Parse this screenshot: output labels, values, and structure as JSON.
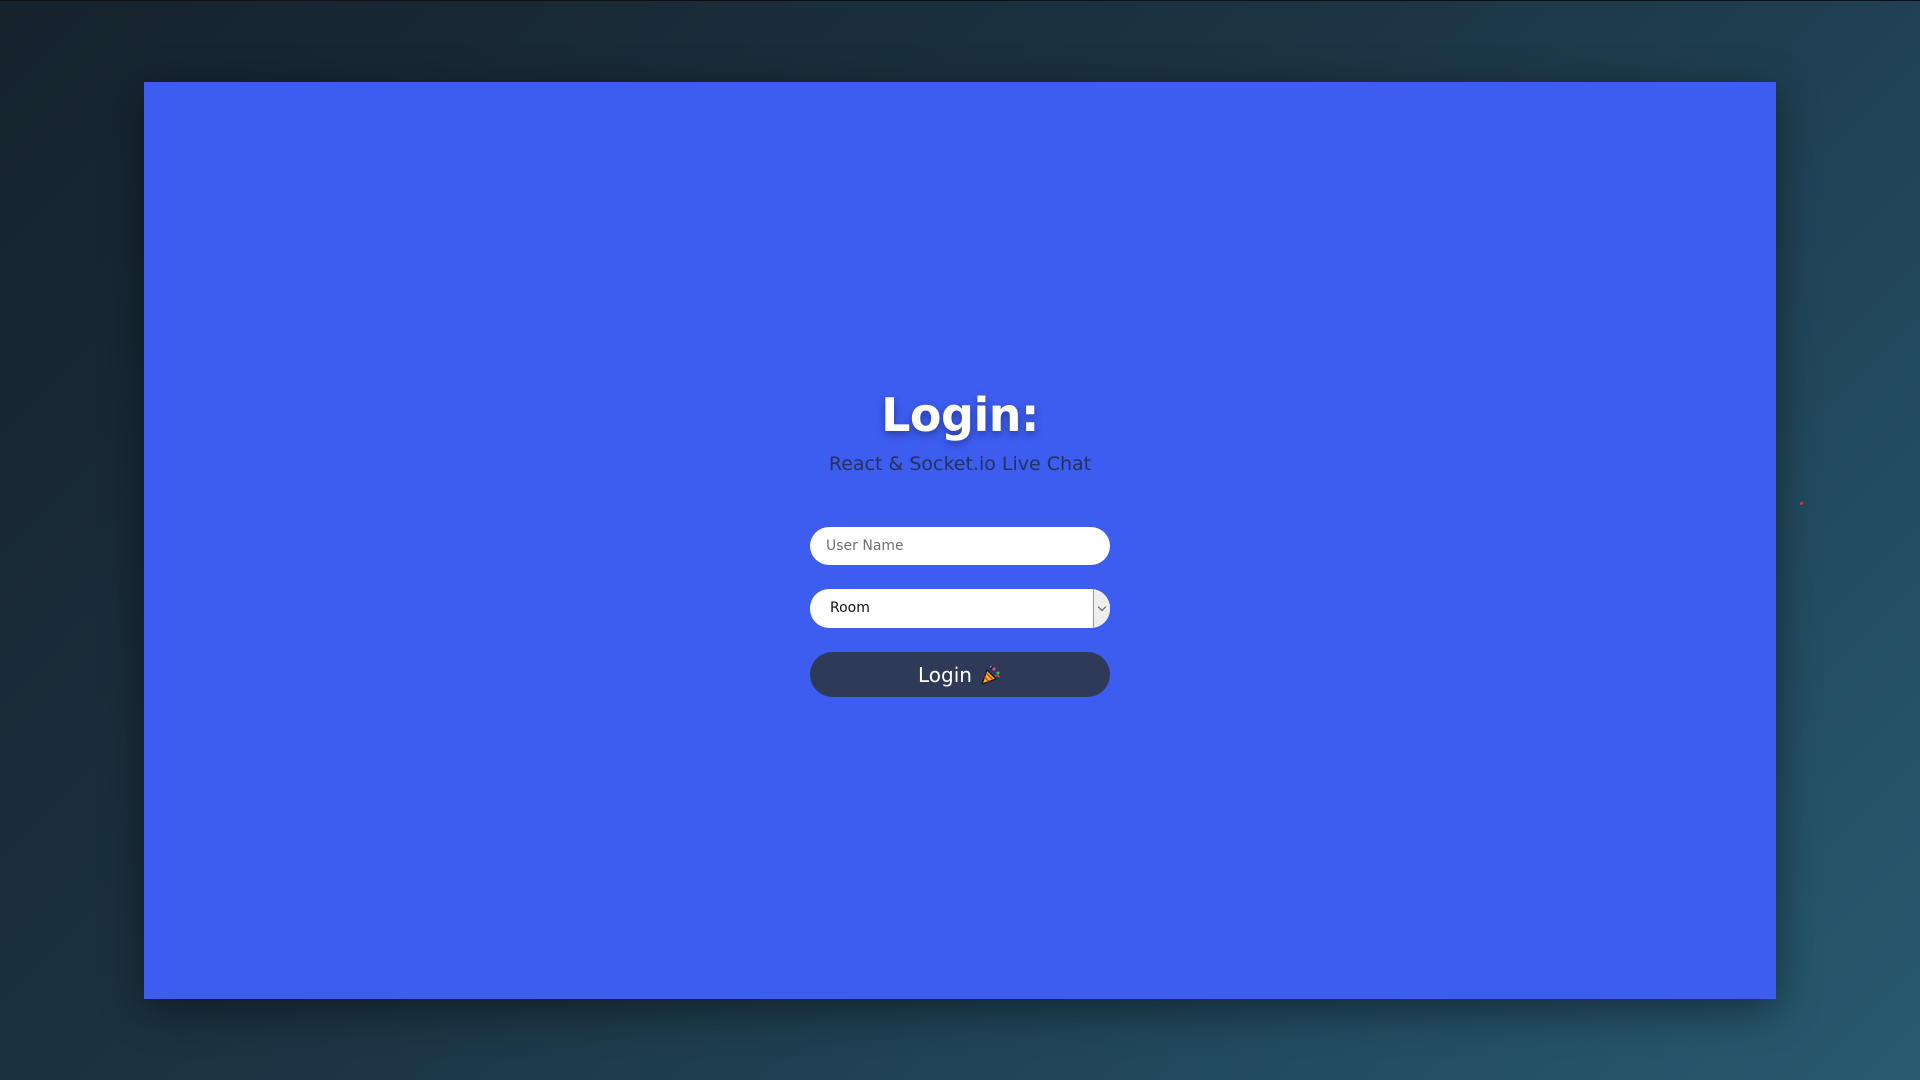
{
  "login": {
    "title": "Login:",
    "subtitle": "React & Socket.io Live Chat",
    "username_placeholder": "User Name",
    "room_value": "Room",
    "button_label": "Login",
    "button_icon": "party-popper-icon"
  },
  "colors": {
    "app_background": "#3d5cf0",
    "button_background": "#2f3a58",
    "subtitle_text": "#23325e",
    "page_background": "#1c3443"
  }
}
